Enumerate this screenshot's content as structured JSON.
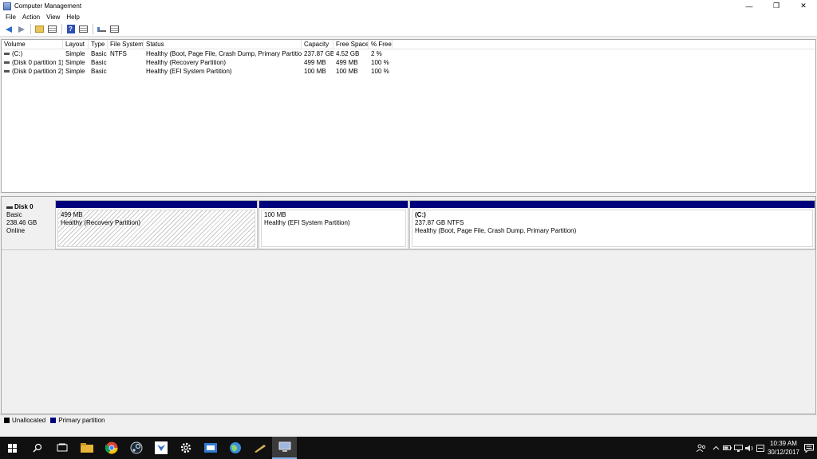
{
  "window": {
    "title": "Computer Management",
    "controls": {
      "minimize": "—",
      "restore": "❐",
      "close": "✕"
    }
  },
  "menu": {
    "items": [
      "File",
      "Action",
      "View",
      "Help"
    ]
  },
  "toolbar": {
    "icons": [
      "back-arrow-icon",
      "forward-arrow-icon",
      "folder-icon",
      "properties-icon",
      "help-icon",
      "list-view-icon",
      "connect-icon",
      "settings-view-icon"
    ],
    "help_glyph": "?"
  },
  "volume_list": {
    "columns": [
      "Volume",
      "Layout",
      "Type",
      "File System",
      "Status",
      "Capacity",
      "Free Space",
      "% Free"
    ],
    "rows": [
      [
        "(C:)",
        "Simple",
        "Basic",
        "NTFS",
        "Healthy (Boot, Page File, Crash Dump, Primary Partition)",
        "237.87 GB",
        "4.52 GB",
        "2 %"
      ],
      [
        "(Disk 0 partition 1)",
        "Simple",
        "Basic",
        "",
        "Healthy (Recovery Partition)",
        "499 MB",
        "499 MB",
        "100 %"
      ],
      [
        "(Disk 0 partition 2)",
        "Simple",
        "Basic",
        "",
        "Healthy (EFI System Partition)",
        "100 MB",
        "100 MB",
        "100 %"
      ]
    ]
  },
  "disk": {
    "name": "Disk 0",
    "type": "Basic",
    "size": "238.46 GB",
    "status": "Online",
    "partitions": [
      {
        "label": "",
        "size": "499 MB",
        "status": "Healthy (Recovery Partition)"
      },
      {
        "label": "",
        "size": "100 MB",
        "status": "Healthy (EFI System Partition)"
      },
      {
        "label": "(C:)",
        "size": "237.87 GB NTFS",
        "status": "Healthy (Boot, Page File, Crash Dump, Primary Partition)"
      }
    ]
  },
  "legend": [
    {
      "label": "Unallocated",
      "color": "#000000"
    },
    {
      "label": "Primary partition",
      "color": "#00007c"
    }
  ],
  "taskbar": {
    "apps": [
      "search-icon",
      "task-view-icon",
      "file-explorer-icon",
      "chrome-icon",
      "steam-icon",
      "app-icon",
      "settings-icon",
      "mail-icon",
      "globe-icon",
      "pen-icon",
      "computer-management-icon"
    ],
    "tray": [
      "people-icon",
      "chevron-up-icon",
      "battery-icon",
      "network-icon",
      "volume-icon",
      "language-icon"
    ],
    "time": "10:39 AM",
    "date": "30/12/2017"
  }
}
